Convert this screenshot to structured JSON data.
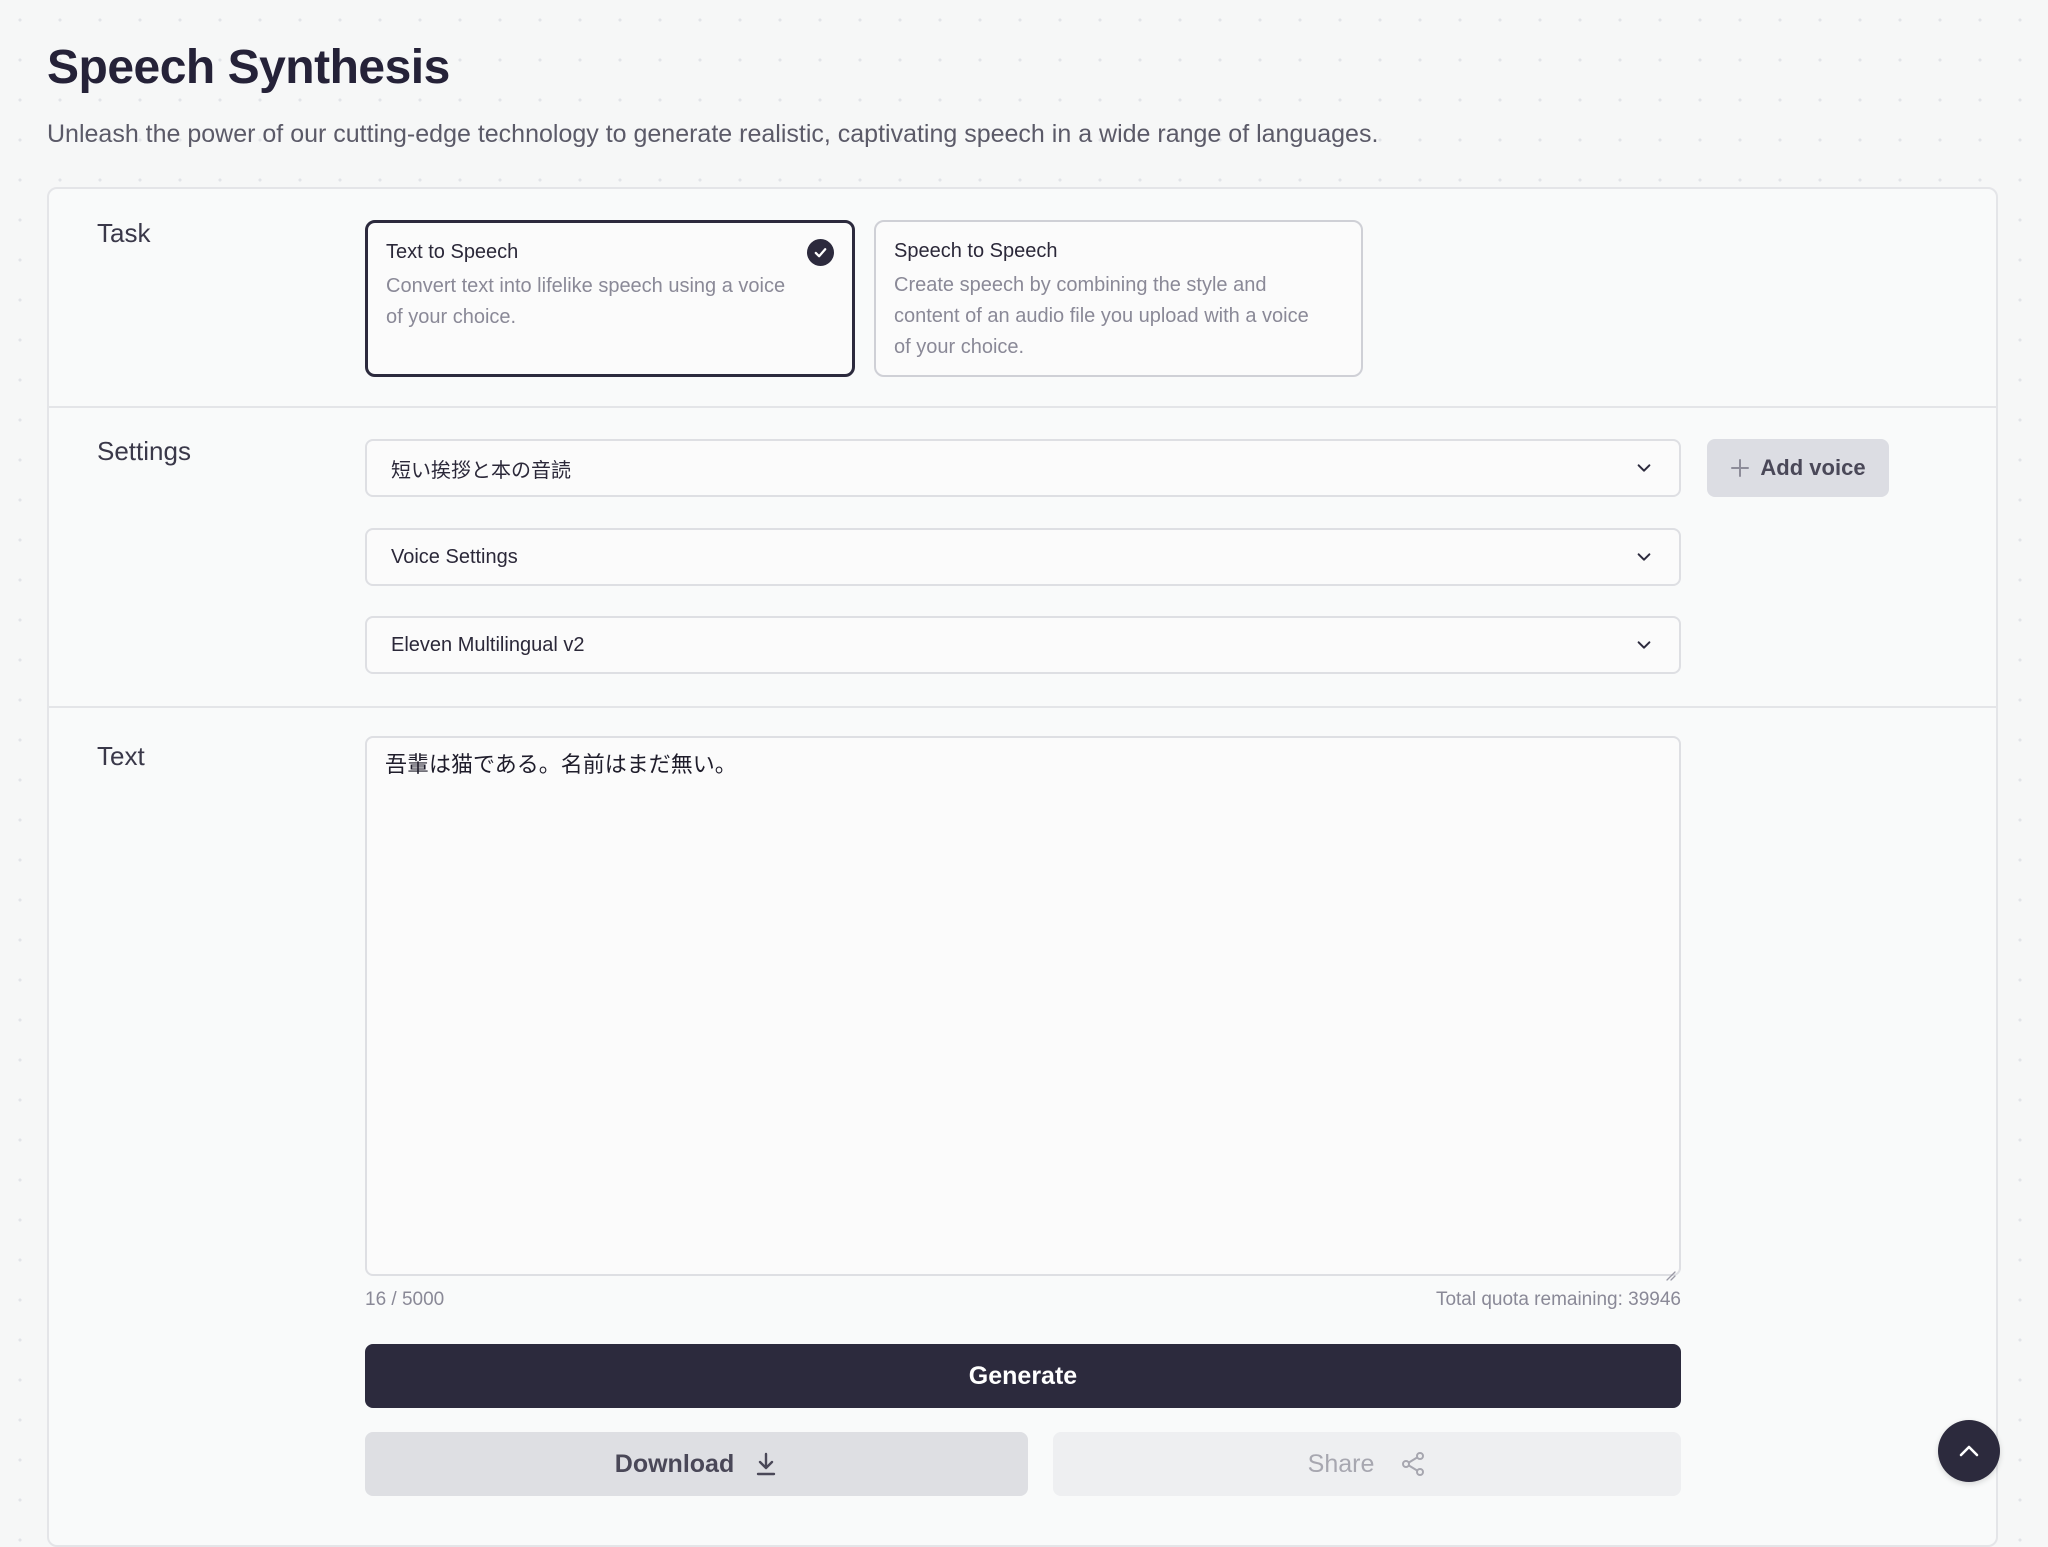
{
  "page": {
    "title": "Speech Synthesis",
    "subtitle": "Unleash the power of our cutting-edge technology to generate realistic, captivating speech in a wide range of languages."
  },
  "task": {
    "label": "Task",
    "options": [
      {
        "title": "Text to Speech",
        "description": "Convert text into lifelike speech using a voice of your choice.",
        "selected": true
      },
      {
        "title": "Speech to Speech",
        "description": "Create speech by combining the style and content of an audio file you upload with a voice of your choice.",
        "selected": false
      }
    ]
  },
  "settings": {
    "label": "Settings",
    "voice_select": "短い挨拶と本の音読",
    "add_voice_label": "Add voice",
    "voice_settings_label": "Voice Settings",
    "model_select": "Eleven Multilingual v2"
  },
  "text": {
    "label": "Text",
    "value": "吾輩は猫である。名前はまだ無い。",
    "char_count": "16 / 5000",
    "quota": "Total quota remaining: 39946"
  },
  "actions": {
    "generate_label": "Generate",
    "download_label": "Download",
    "share_label": "Share"
  },
  "icons": {
    "selected_check": "check-circle-icon",
    "dropdown": "chevron-down-icon",
    "add": "plus-icon",
    "download": "download-icon",
    "share": "share-icon",
    "scroll_top": "chevron-up-icon"
  },
  "colors": {
    "primary": "#2c2a3d",
    "background": "#f6f7f7",
    "muted_text": "#8a8997",
    "border": "#dedfe3"
  }
}
